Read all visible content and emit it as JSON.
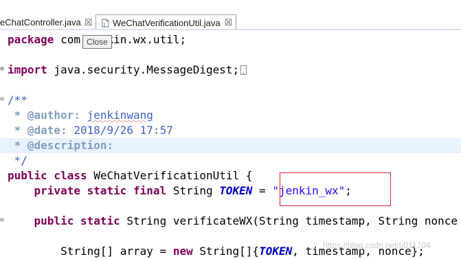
{
  "tabs": [
    {
      "label": "eChatController.java",
      "close": "☒"
    },
    {
      "label": "WeChatVerificationUtil.java",
      "close": "☒"
    }
  ],
  "tooltip": "Close",
  "code": {
    "l1_kw": "package",
    "l1_rest": " com.jenkin.wx.util;",
    "l2_kw": "import",
    "l2_rest": " java.security.MessageDigest;",
    "c_open": "/**",
    "c_author_tag": " * @author:",
    "c_author_val": "jenkinwang",
    "c_date_tag": " * @date:",
    "c_date_val": " 2018/9/26 17:57",
    "c_desc_tag": " * @description:",
    "c_close": " */",
    "class_kw": "public class",
    "class_rest": " WeChatVerificationUtil {",
    "field_kw": "    private static final",
    "field_type": " String ",
    "field_name": "TOKEN",
    "field_eq": " = ",
    "field_str": "\"jenkin_wx\"",
    "field_end": ";",
    "method_kw": "    public static",
    "method_rest": " String verificateWX(String timestamp, String nonce",
    "arr_pre": "        String[] array = ",
    "arr_new": "new",
    "arr_mid": " String[]{",
    "arr_token": "TOKEN",
    "arr_end": ", timestamp, nonce};"
  },
  "watermark": "https://blog.csdn.net/u011704",
  "colors": {
    "keyword": "#7f0055",
    "comment": "#3f5fbf",
    "javadoc_tag": "#7f9fbf",
    "string": "#2a00ff",
    "constant": "#0000c0",
    "highlight": "#e8f2fe",
    "box": "#d9242e"
  }
}
